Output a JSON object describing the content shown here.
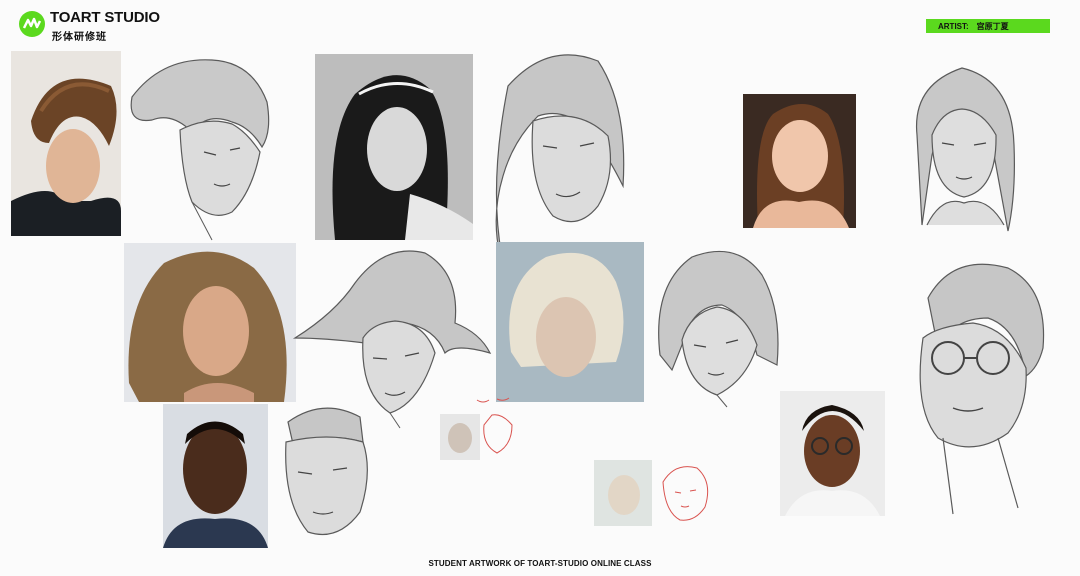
{
  "logo": {
    "title": "TOART STUDIO",
    "subtitle": "形体研修班",
    "brand_color": "#5bd91e",
    "icon": "toart-logo-icon"
  },
  "artist": {
    "label": "ARTIST:",
    "name": "宫原丁夏"
  },
  "footer": {
    "caption": "STUDENT ARTWORK OF TOART-STUDIO ONLINE CLASS"
  },
  "colors": {
    "background": "#fbfbfb",
    "sketch_fill": "#d4d4d4",
    "sketch_stroke": "#5a5a5a",
    "red_line": "#d9534f"
  },
  "artworks": [
    {
      "photo": "young-man-brown-hair-photo",
      "sketch": "young-man-stylized-sketch"
    },
    {
      "photo": "woman-headband-bw-photo",
      "sketch": "woman-long-hair-sketch"
    },
    {
      "photo": "girl-hands-chin-photo",
      "sketch": "girl-hands-chin-sketch"
    },
    {
      "photo": "woman-windblown-hair-photo",
      "sketch": "woman-windblown-sketch"
    },
    {
      "photo": "woman-platinum-bob-photo",
      "sketch": "woman-bob-sketch"
    },
    {
      "photo": "man-glasses-photo",
      "sketch": "man-glasses-sketch"
    },
    {
      "photo": "man-short-hair-photo",
      "sketch": "man-angular-sketch"
    },
    {
      "photo": "small-thumbnail-study",
      "sketch": "red-line-thumbnail-study"
    },
    {
      "photo": "blonde-thumbnail-study",
      "sketch": "red-line-blonde-study"
    }
  ]
}
